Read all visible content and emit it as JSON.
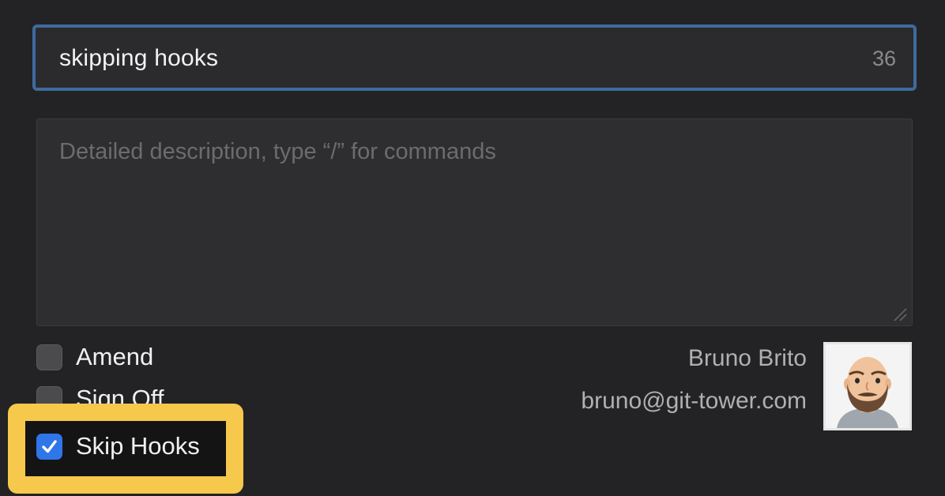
{
  "commit": {
    "summary_value": "skipping hooks",
    "summary_char_count": "36",
    "description_placeholder": "Detailed description, type “/” for commands"
  },
  "options": {
    "amend_label": "Amend",
    "amend_checked": false,
    "signoff_label": "Sign Off",
    "signoff_checked": false,
    "skip_hooks_label": "Skip Hooks",
    "skip_hooks_checked": true
  },
  "author": {
    "name": "Bruno Brito",
    "email": "bruno@git-tower.com"
  },
  "colors": {
    "background": "#232325",
    "focus_ring": "#3f6a9e",
    "checkbox_checked": "#2f76e8",
    "highlight": "#f6c84b"
  },
  "icons": [
    "checkmark-icon",
    "resize-grip-icon",
    "avatar-icon"
  ]
}
